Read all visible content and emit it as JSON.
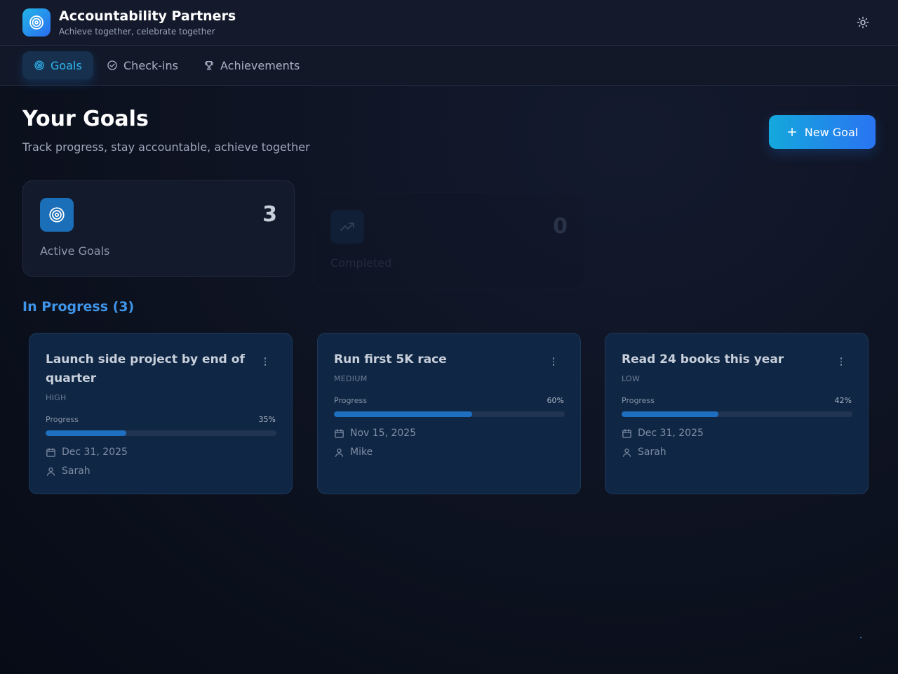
{
  "app": {
    "title": "Accountability Partners",
    "subtitle": "Achieve together, celebrate together",
    "logo_icon": "target-icon",
    "theme_toggle_icon": "sun-icon"
  },
  "tabs": [
    {
      "label": "Goals",
      "icon": "target-icon",
      "active": true
    },
    {
      "label": "Check-ins",
      "icon": "check-circle-icon",
      "active": false
    },
    {
      "label": "Achievements",
      "icon": "trophy-icon",
      "active": false
    }
  ],
  "page": {
    "title": "Your Goals",
    "subtitle": "Track progress, stay accountable, achieve together",
    "new_goal_label": "New Goal"
  },
  "stats": [
    {
      "label": "Active Goals",
      "value": "3",
      "icon": "target-icon"
    },
    {
      "label": "Completed",
      "value": "0",
      "icon": "trending-up-icon"
    }
  ],
  "section": {
    "title": "In Progress (3)"
  },
  "goals": [
    {
      "title": "Launch side project by end of quarter",
      "priority": "HIGH",
      "progress_label": "Progress",
      "progress": 35,
      "progress_text": "35%",
      "due_date": "Dec 31, 2025",
      "partner": "Sarah"
    },
    {
      "title": "Run first 5K race",
      "priority": "MEDIUM",
      "progress_label": "Progress",
      "progress": 60,
      "progress_text": "60%",
      "due_date": "Nov 15, 2025",
      "partner": "Mike"
    },
    {
      "title": "Read 24 books this year",
      "priority": "LOW",
      "progress_label": "Progress",
      "progress": 42,
      "progress_text": "42%",
      "due_date": "Dec 31, 2025",
      "partner": "Sarah"
    }
  ],
  "colors": {
    "accent": "#2fb3ec",
    "brand_gradient_start": "#14a8dc",
    "brand_gradient_end": "#2a74f2",
    "section_title": "#3f95e8",
    "progress_fill": "#1e6fbf"
  }
}
